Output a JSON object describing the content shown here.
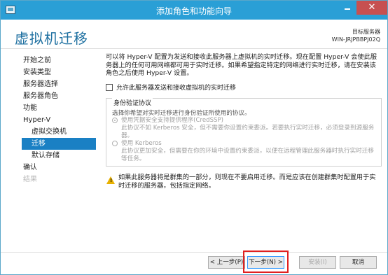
{
  "window": {
    "title": "添加角色和功能向导",
    "minimize_symbol": "",
    "close_symbol": "✕"
  },
  "header": {
    "page_title": "虚拟机迁移",
    "target_label": "目标服务器",
    "target_name": "WIN-JRJPBBPJ02Q"
  },
  "nav": {
    "items": [
      {
        "label": "开始之前",
        "state": "normal"
      },
      {
        "label": "安装类型",
        "state": "normal"
      },
      {
        "label": "服务器选择",
        "state": "normal"
      },
      {
        "label": "服务器角色",
        "state": "normal"
      },
      {
        "label": "功能",
        "state": "normal"
      },
      {
        "label": "Hyper-V",
        "state": "normal"
      },
      {
        "label": "虚拟交换机",
        "state": "sub"
      },
      {
        "label": "迁移",
        "state": "active"
      },
      {
        "label": "默认存储",
        "state": "sub"
      },
      {
        "label": "确认",
        "state": "normal"
      },
      {
        "label": "结果",
        "state": "disabled"
      }
    ]
  },
  "main": {
    "intro": "可以将 Hyper-V 配置为发送和接收此服务器上虚拟机的实时迁移。现在配置 Hyper-V 会使此服务器上的任何可用网络都可用于实时迁移。如果希望指定特定的网络进行实时迁移，请在安装该角色之后使用 Hyper-V 设置。",
    "checkbox_label": "允许此服务器发送和接收虚拟机的实时迁移",
    "auth_group": {
      "title": "身份验证协议",
      "description": "选择你希望对实时迁移进行身份验证所使用的协议。",
      "option1_label": "使用凭据安全支持提供程序(CredSSP)",
      "option1_desc": "此协议不如 Kerberos 安全，但不需要你设置约束委派。若要执行实时迁移，必须登录到源服务器。",
      "option2_label": "使用 Kerberos",
      "option2_desc": "此协议更加安全，但需要在你的环境中设置约束委派，以便在远程管理此服务器时执行实时迁移等任务。"
    },
    "warning": "如果此服务器将是群集的一部分，则现在不要启用迁移。而是应该在创建群集时配置用于实时迁移的服务器，包括指定网络。"
  },
  "footer": {
    "prev_label": "< 上一步(P)",
    "next_label": "下一步(N) >",
    "install_label": "安装(I)",
    "cancel_label": "取消"
  },
  "colors": {
    "titlebar": "#2a9fd6",
    "accent": "#1a80c4",
    "highlight": "#e02020"
  }
}
